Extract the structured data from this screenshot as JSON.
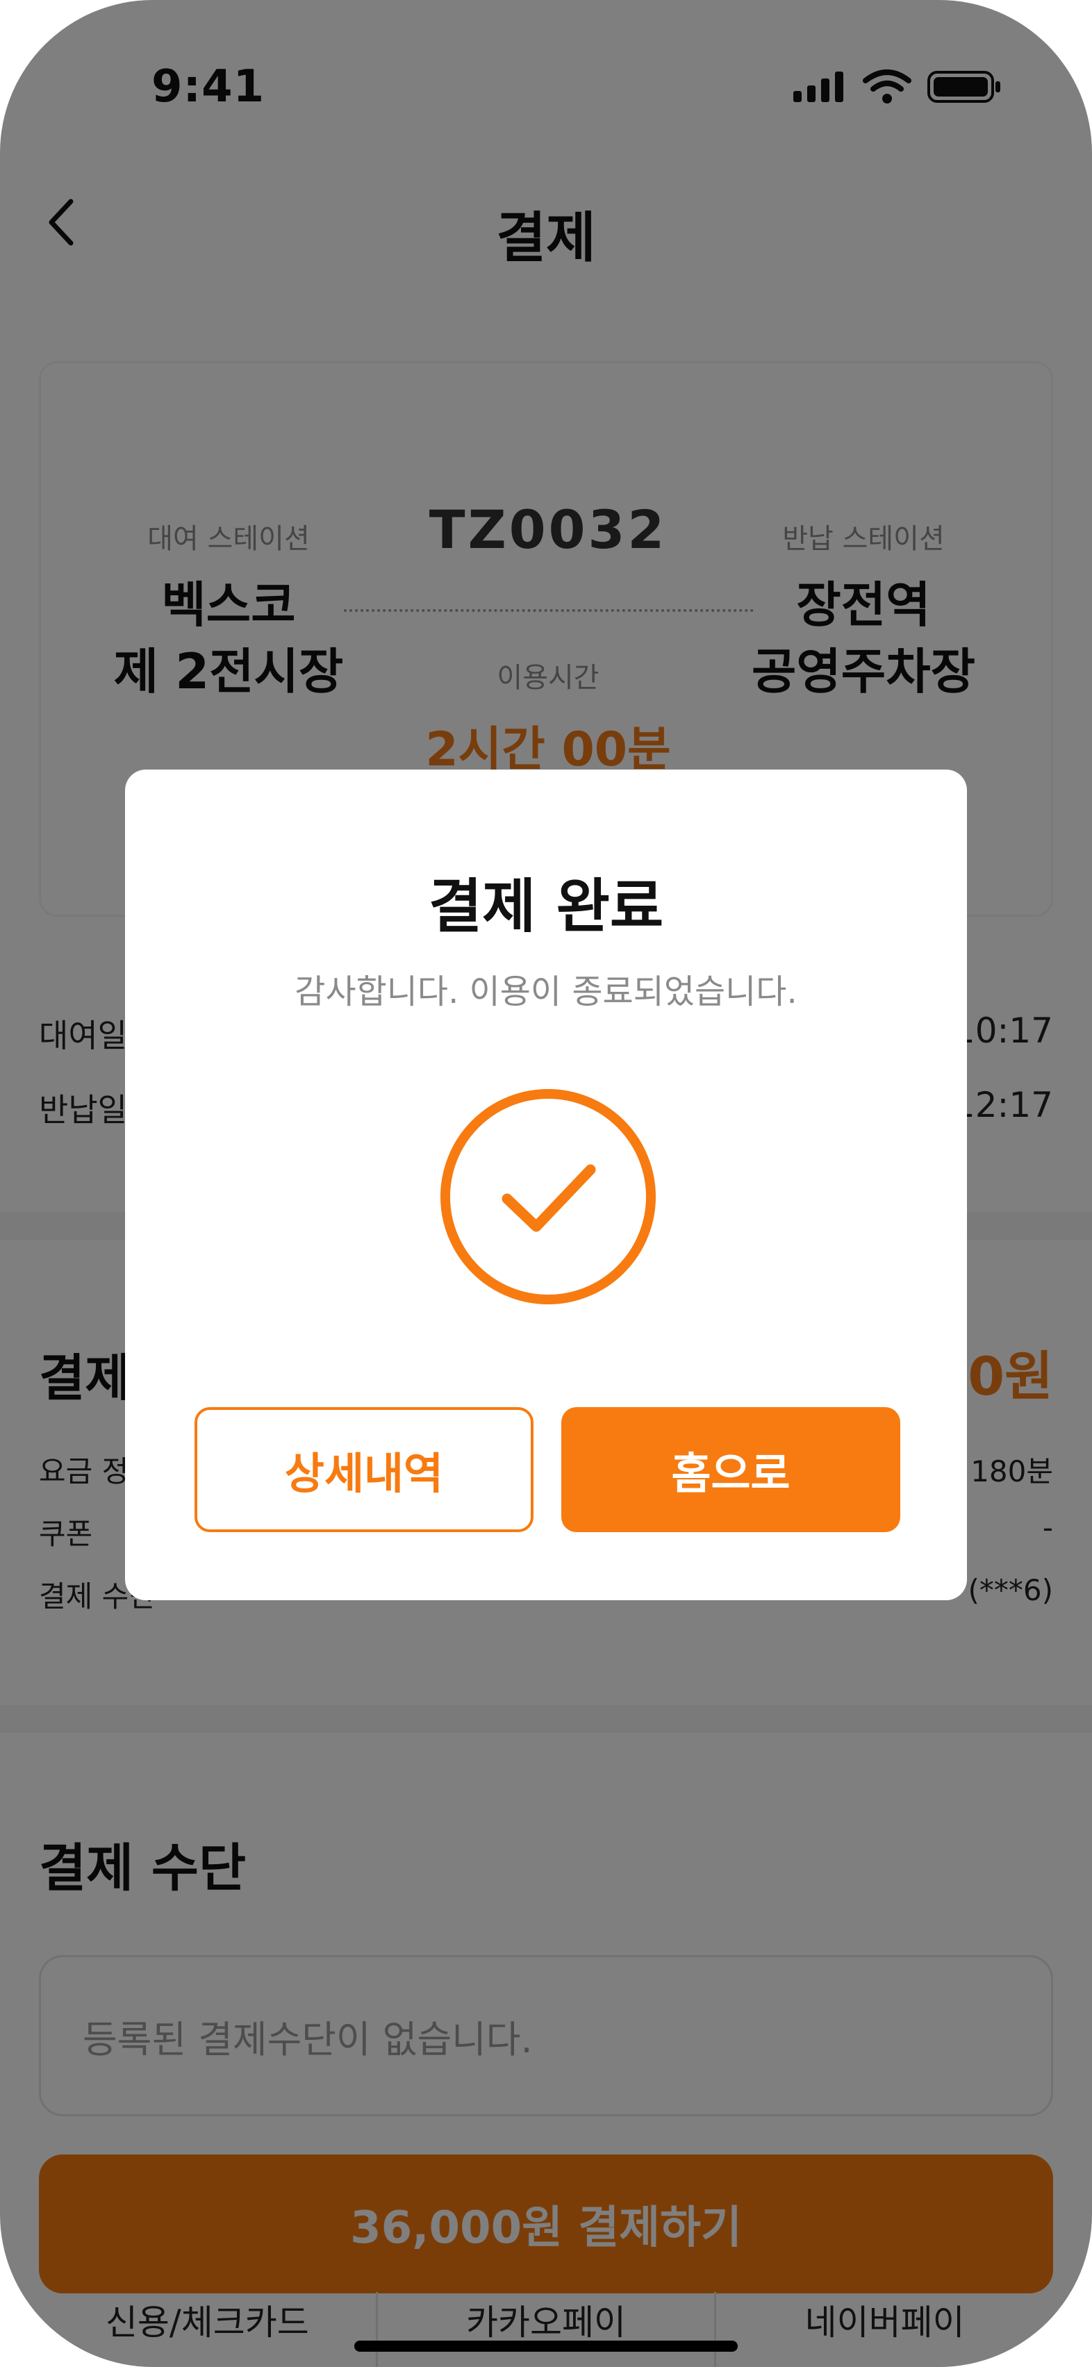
{
  "status_bar": {
    "time": "9:41"
  },
  "nav": {
    "title": "결제"
  },
  "trip": {
    "vehicle_id": "TZ0032",
    "rental_station": {
      "label": "대여 스테이션",
      "name_line1": "벡스코",
      "name_line2": "제 2전시장"
    },
    "return_station": {
      "label": "반납 스테이션",
      "name_line1": "장전역",
      "name_line2": "공영주차장"
    },
    "usage_time_label": "이용시간",
    "usage_time_value": "2시간 00분"
  },
  "info_rows": [
    {
      "label": "대여일",
      "value": "10:17"
    },
    {
      "label": "반납일",
      "value": "12:17"
    }
  ],
  "payment_info": {
    "title": "결제",
    "total": "0원",
    "rows": [
      {
        "label": "요금 정",
        "value": "180분"
      },
      {
        "label": "쿠폰",
        "value": "-"
      },
      {
        "label": "결제 수단",
        "value": "(***6)"
      }
    ]
  },
  "payment_method": {
    "title": "결제 수단",
    "empty_text": "등록된 결제수단이 없습니다.",
    "pay_button": "36,000원 결제하기",
    "tabs": [
      "신용/체크카드",
      "카카오페이",
      "네이버페이"
    ]
  },
  "modal": {
    "title": "결제 완료",
    "message": "감사합니다. 이용이 종료되었습니다.",
    "detail_button": "상세내역",
    "home_button": "홈으로"
  },
  "colors": {
    "accent": "#f77b10",
    "overlay": "rgba(0,0,0,0.5)"
  }
}
